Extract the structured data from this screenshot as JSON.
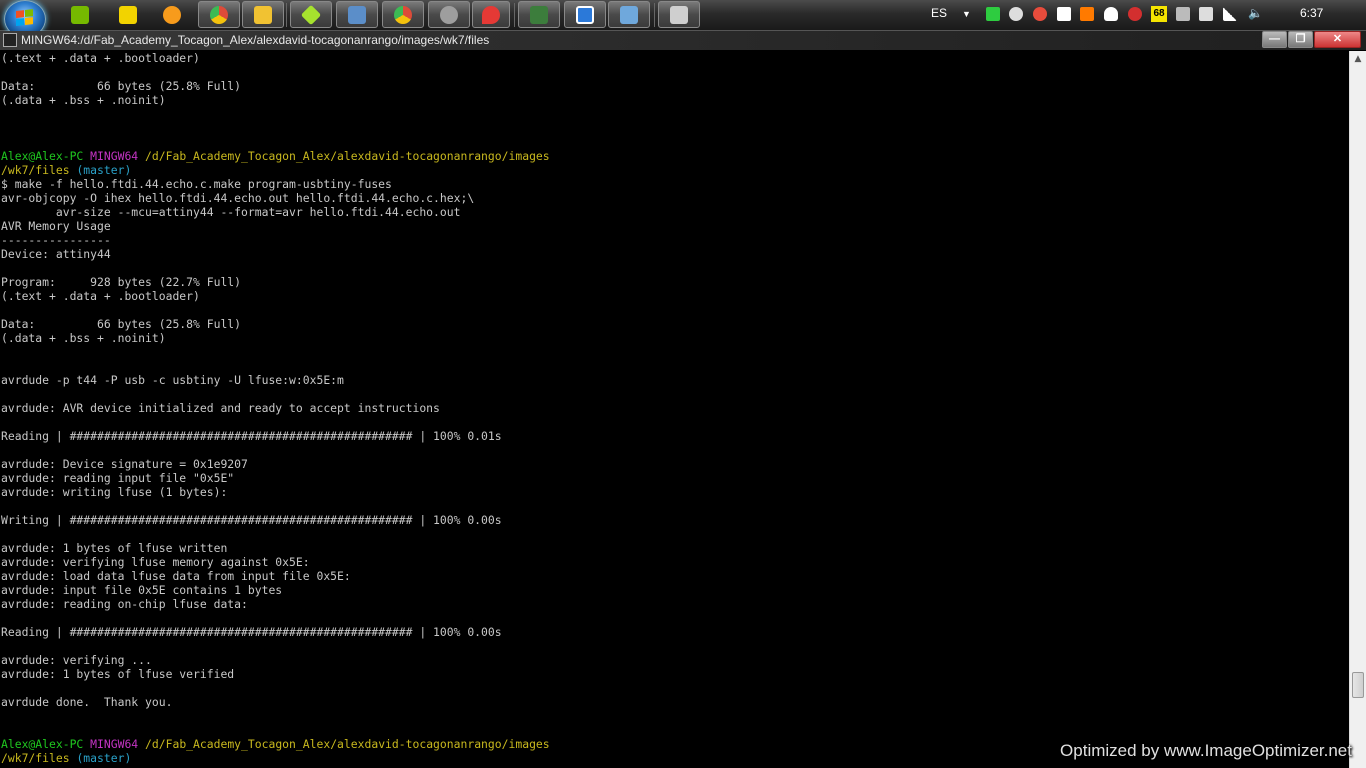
{
  "taskbar": {
    "apps": [
      {
        "name": "nvidia",
        "color": "#76b900"
      },
      {
        "name": "winamp",
        "color": "#f2d300"
      },
      {
        "name": "media-player",
        "color": "#f79b1c"
      },
      {
        "name": "chrome",
        "color": "#dd4b39"
      },
      {
        "name": "explorer",
        "color": "#f1c232"
      },
      {
        "name": "git",
        "color": "#a6e22e"
      },
      {
        "name": "document",
        "color": "#5b8ec9"
      },
      {
        "name": "chrome-2",
        "color": "#dd4b39"
      },
      {
        "name": "gimp",
        "color": "#9e9e9e"
      },
      {
        "name": "inkscape",
        "color": "#e53935"
      },
      {
        "name": "terminal",
        "color": "#3c7d3c"
      },
      {
        "name": "window-app",
        "color": "#2b79d9"
      },
      {
        "name": "folder-window",
        "color": "#6fa8dc"
      },
      {
        "name": "calculator",
        "color": "#cfcfcf"
      }
    ],
    "tray": {
      "language": "ES",
      "badge": "68",
      "clock": "6:37"
    }
  },
  "window": {
    "title": "MINGW64:/d/Fab_Academy_Tocagon_Alex/alexdavid-tocagonanrango/images/wk7/files",
    "minimize": "—",
    "maximize": "❐",
    "close": "✕"
  },
  "terminal": {
    "colors": {
      "user": "#1fc81f",
      "shell": "#c334c3",
      "path": "#c8b81e",
      "branch": "#2aa1c8",
      "text": "#c8c8c8"
    },
    "l0": "(.text + .data + .bootloader)",
    "l1": "",
    "l2": "Data:         66 bytes (25.8% Full)",
    "l3": "(.data + .bss + .noinit)",
    "l4": "",
    "l5": "",
    "l6": "",
    "prompt1": {
      "user": "Alex@Alex-PC",
      "shell": "MINGW64",
      "path1": "/d/Fab_Academy_Tocagon_Alex/alexdavid-tocagonanrango/images",
      "path2": "/wk7/files",
      "branch": "(master)"
    },
    "l9": "$ make -f hello.ftdi.44.echo.c.make program-usbtiny-fuses",
    "l10": "avr-objcopy -O ihex hello.ftdi.44.echo.out hello.ftdi.44.echo.c.hex;\\",
    "l11": "        avr-size --mcu=attiny44 --format=avr hello.ftdi.44.echo.out",
    "l12": "AVR Memory Usage",
    "l13": "----------------",
    "l14": "Device: attiny44",
    "l15": "",
    "l16": "Program:     928 bytes (22.7% Full)",
    "l17": "(.text + .data + .bootloader)",
    "l18": "",
    "l19": "Data:         66 bytes (25.8% Full)",
    "l20": "(.data + .bss + .noinit)",
    "l21": "",
    "l22": "",
    "l23": "avrdude -p t44 -P usb -c usbtiny -U lfuse:w:0x5E:m",
    "l24": "",
    "l25": "avrdude: AVR device initialized and ready to accept instructions",
    "l26": "",
    "l27": "Reading | ################################################## | 100% 0.01s",
    "l28": "",
    "l29": "avrdude: Device signature = 0x1e9207",
    "l30": "avrdude: reading input file \"0x5E\"",
    "l31": "avrdude: writing lfuse (1 bytes):",
    "l32": "",
    "l33": "Writing | ################################################## | 100% 0.00s",
    "l34": "",
    "l35": "avrdude: 1 bytes of lfuse written",
    "l36": "avrdude: verifying lfuse memory against 0x5E:",
    "l37": "avrdude: load data lfuse data from input file 0x5E:",
    "l38": "avrdude: input file 0x5E contains 1 bytes",
    "l39": "avrdude: reading on-chip lfuse data:",
    "l40": "",
    "l41": "Reading | ################################################## | 100% 0.00s",
    "l42": "",
    "l43": "avrdude: verifying ...",
    "l44": "avrdude: 1 bytes of lfuse verified",
    "l45": "",
    "l46": "avrdude done.  Thank you.",
    "l47": "",
    "l48": "",
    "prompt2": {
      "user": "Alex@Alex-PC",
      "shell": "MINGW64",
      "path1": "/d/Fab_Academy_Tocagon_Alex/alexdavid-tocagonanrango/images",
      "path2": "/wk7/files",
      "branch": "(master)"
    }
  },
  "scrollbar": {
    "up": "▲",
    "down": "▼"
  },
  "watermark": "Optimized by www.ImageOptimizer.net"
}
